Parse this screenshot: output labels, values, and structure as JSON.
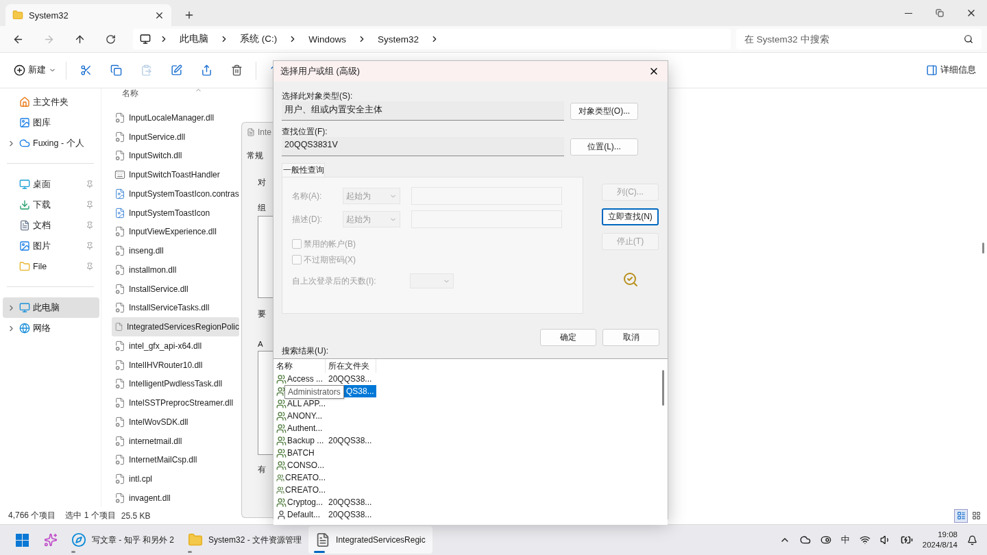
{
  "explorer": {
    "tab": {
      "title": "System32"
    },
    "breadcrumb": [
      "此电脑",
      "系统 (C:)",
      "Windows",
      "System32"
    ],
    "search": {
      "placeholder": "在 System32 中搜索"
    },
    "command_bar": {
      "new_label": "新建",
      "paste_disabled": true,
      "details_label": "详细信息"
    },
    "sidebar": {
      "groups": [
        [
          {
            "label": "主文件夹",
            "expandable": false,
            "pinned": false,
            "selected": false
          },
          {
            "label": "图库",
            "expandable": false,
            "pinned": false,
            "selected": false
          },
          {
            "label": "Fuxing - 个人",
            "expandable": true,
            "pinned": false,
            "selected": false
          }
        ],
        [
          {
            "label": "桌面",
            "expandable": false,
            "pinned": true,
            "selected": false
          },
          {
            "label": "下载",
            "expandable": false,
            "pinned": true,
            "selected": false
          },
          {
            "label": "文档",
            "expandable": false,
            "pinned": true,
            "selected": false
          },
          {
            "label": "图片",
            "expandable": false,
            "pinned": true,
            "selected": false
          },
          {
            "label": "File",
            "expandable": false,
            "pinned": true,
            "selected": false
          }
        ],
        [
          {
            "label": "此电脑",
            "expandable": true,
            "pinned": false,
            "selected": true
          },
          {
            "label": "网络",
            "expandable": true,
            "pinned": false,
            "selected": false
          }
        ]
      ]
    },
    "file_list": {
      "column": "名称",
      "files": [
        {
          "name": "InputLocaleManager.dll",
          "kind": "dll",
          "selected": false
        },
        {
          "name": "InputService.dll",
          "kind": "dll",
          "selected": false
        },
        {
          "name": "InputSwitch.dll",
          "kind": "dll",
          "selected": false
        },
        {
          "name": "InputSwitchToastHandler",
          "kind": "app",
          "selected": false
        },
        {
          "name": "InputSystemToastIcon.contras",
          "kind": "image",
          "selected": false
        },
        {
          "name": "InputSystemToastIcon",
          "kind": "image",
          "selected": false
        },
        {
          "name": "InputViewExperience.dll",
          "kind": "dll",
          "selected": false
        },
        {
          "name": "inseng.dll",
          "kind": "dll",
          "selected": false
        },
        {
          "name": "installmon.dll",
          "kind": "dll",
          "selected": false
        },
        {
          "name": "InstallService.dll",
          "kind": "dll",
          "selected": false
        },
        {
          "name": "InstallServiceTasks.dll",
          "kind": "dll",
          "selected": false
        },
        {
          "name": "IntegratedServicesRegionPolic",
          "kind": "doc",
          "selected": true
        },
        {
          "name": "intel_gfx_api-x64.dll",
          "kind": "dll",
          "selected": false
        },
        {
          "name": "IntelIHVRouter10.dll",
          "kind": "dll",
          "selected": false
        },
        {
          "name": "IntelligentPwdlessTask.dll",
          "kind": "dll",
          "selected": false
        },
        {
          "name": "IntelSSTPreprocStreamer.dll",
          "kind": "dll",
          "selected": false
        },
        {
          "name": "IntelWovSDK.dll",
          "kind": "dll",
          "selected": false
        },
        {
          "name": "internetmail.dll",
          "kind": "dll",
          "selected": false
        },
        {
          "name": "InternetMailCsp.dll",
          "kind": "dll",
          "selected": false
        },
        {
          "name": "intl.cpl",
          "kind": "dll",
          "selected": false
        },
        {
          "name": "invagent.dll",
          "kind": "dll",
          "selected": false
        }
      ]
    },
    "status_bar": {
      "count": "4,766 个项目",
      "selection": "选中 1 个项目",
      "size": "25.5 KB"
    }
  },
  "properties_window": {
    "title": "Inte",
    "tab": "常规",
    "labels": [
      "对",
      "组",
      "要",
      "A",
      "有"
    ]
  },
  "dialog": {
    "title": "选择用户或组 (高级)",
    "object_type": {
      "label": "选择此对象类型(S):",
      "value": "用户、组或内置安全主体",
      "button": "对象类型(O)..."
    },
    "location": {
      "label": "查找位置(F):",
      "value": "20QQS3831V",
      "button": "位置(L)..."
    },
    "tab": "一般性查询",
    "query": {
      "disabled": true,
      "name_label": "名称(A):",
      "name_mode": "起始为",
      "desc_label": "描述(D):",
      "desc_mode": "起始为",
      "checkboxes": [
        {
          "label": "禁用的帐户(B)",
          "checked": false
        },
        {
          "label": "不过期密码(X)",
          "checked": false
        }
      ],
      "days_label": "自上次登录后的天数(I):"
    },
    "side_buttons": [
      {
        "label": "列(C)...",
        "disabled": true,
        "default": false
      },
      {
        "label": "立即查找(N)",
        "disabled": false,
        "default": true
      },
      {
        "label": "停止(T)",
        "disabled": true,
        "default": false
      }
    ],
    "ok": "确定",
    "cancel": "取消",
    "results": {
      "label": "搜索结果(U):",
      "columns": [
        "名称",
        "所在文件夹"
      ],
      "tooltip": "Administrators",
      "rows": [
        {
          "name": "Access ...",
          "folder": "20QQS38...",
          "kind": "group",
          "selected": false
        },
        {
          "folder": "QS38...",
          "kind": "group",
          "selected": true
        },
        {
          "name": "ALL APP...",
          "kind": "group",
          "selected": false
        },
        {
          "name": "ANONY...",
          "kind": "group",
          "selected": false
        },
        {
          "name": "Authent...",
          "kind": "group",
          "selected": false
        },
        {
          "name": "Backup ...",
          "folder": "20QQS38...",
          "kind": "group",
          "selected": false
        },
        {
          "name": "BATCH",
          "kind": "group",
          "selected": false
        },
        {
          "name": "CONSO...",
          "kind": "group",
          "selected": false
        },
        {
          "name": "CREATO...",
          "kind": "group",
          "selected": false
        },
        {
          "name": "CREATO...",
          "kind": "group",
          "selected": false
        },
        {
          "name": "Cryptog...",
          "folder": "20QQS38...",
          "kind": "group",
          "selected": false
        },
        {
          "name": "Default...",
          "folder": "20QQS38...",
          "kind": "user",
          "selected": false
        }
      ]
    }
  },
  "taskbar": {
    "apps": [
      {
        "label": "写文章 - 知乎 和另外 2",
        "kind": "browser",
        "active": false
      },
      {
        "label": "System32 - 文件资源管理",
        "kind": "folder",
        "active": false
      },
      {
        "label": "IntegratedServicesRegic",
        "kind": "document",
        "active": true
      }
    ],
    "ime": "中",
    "time": "19:08",
    "date": "2024/8/14"
  }
}
